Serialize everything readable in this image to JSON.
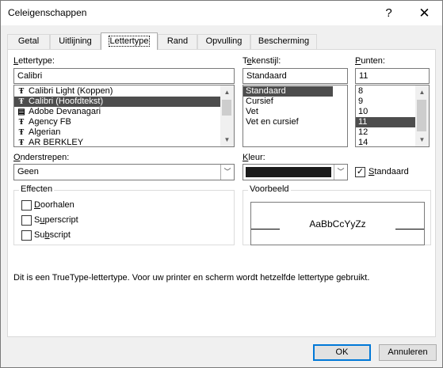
{
  "window": {
    "title": "Celeigenschappen",
    "help": "?",
    "close": "✕"
  },
  "tabs": [
    {
      "label": "Getal"
    },
    {
      "label": "Uitlijning"
    },
    {
      "label": "Lettertype"
    },
    {
      "label": "Rand"
    },
    {
      "label": "Opvulling"
    },
    {
      "label": "Bescherming"
    }
  ],
  "font": {
    "label_pre": "",
    "label_u": "L",
    "label_post": "ettertype:",
    "value": "Calibri",
    "items": [
      {
        "name": "Calibri Light (Koppen)",
        "icon": "truetype-icon"
      },
      {
        "name": "Calibri (Hoofdtekst)",
        "icon": "truetype-icon",
        "selected": true
      },
      {
        "name": "Adobe Devanagari",
        "icon": "printer-font-icon"
      },
      {
        "name": "Agency FB",
        "icon": "truetype-icon"
      },
      {
        "name": "Algerian",
        "icon": "truetype-icon"
      },
      {
        "name": "AR BERKLEY",
        "icon": "truetype-icon"
      }
    ]
  },
  "style": {
    "label_pre": "T",
    "label_u": "e",
    "label_post": "kenstijl:",
    "value": "Standaard",
    "items": [
      "Standaard",
      "Cursief",
      "Vet",
      "Vet en cursief"
    ]
  },
  "size": {
    "label_pre": "",
    "label_u": "P",
    "label_post": "unten:",
    "value": "11",
    "items": [
      "8",
      "9",
      "10",
      "11",
      "12",
      "14"
    ]
  },
  "underline": {
    "label_pre": "",
    "label_u": "O",
    "label_post": "nderstrepen:",
    "value": "Geen"
  },
  "color": {
    "label_pre": "",
    "label_u": "K",
    "label_post": "leur:",
    "swatch": "#1a1a1a",
    "auto_checked": true,
    "auto_label_pre": "",
    "auto_label_u": "S",
    "auto_label_post": "tandaard"
  },
  "effects": {
    "title": "Effecten",
    "items": [
      {
        "pre": "",
        "u": "D",
        "post": "oorhalen"
      },
      {
        "pre": "S",
        "u": "u",
        "post": "perscript"
      },
      {
        "pre": "Su",
        "u": "b",
        "post": "script"
      }
    ]
  },
  "preview": {
    "title": "Voorbeeld",
    "text": "AaBbCcYyZz"
  },
  "info": "Dit is een TrueType-lettertype. Voor uw printer en scherm wordt hetzelfde lettertype gebruikt.",
  "buttons": {
    "ok": "OK",
    "cancel": "Annuleren"
  }
}
